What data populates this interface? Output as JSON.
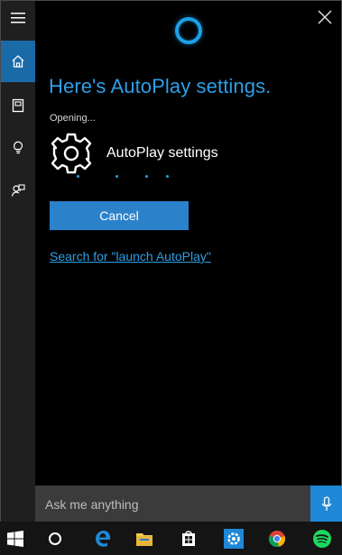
{
  "cortana": {
    "heading": "Here's AutoPlay settings.",
    "status": "Opening...",
    "setting_name": "AutoPlay settings",
    "cancel_label": "Cancel",
    "search_link": "Search for \"launch AutoPlay\""
  },
  "search": {
    "placeholder": "Ask me anything"
  },
  "rail": {
    "items": [
      {
        "name": "menu",
        "icon": "hamburger-icon"
      },
      {
        "name": "home",
        "icon": "home-icon",
        "active": true
      },
      {
        "name": "notebook",
        "icon": "notebook-icon"
      },
      {
        "name": "reminders",
        "icon": "lightbulb-icon"
      },
      {
        "name": "feedback",
        "icon": "feedback-icon"
      }
    ]
  },
  "taskbar": {
    "items": [
      "start-icon",
      "cortana-icon",
      "edge-icon",
      "file-explorer-icon",
      "store-icon",
      "settings-icon",
      "chrome-icon",
      "spotify-icon"
    ]
  },
  "colors": {
    "accent": "#2d9fe6",
    "button": "#2b82cb",
    "rail_active": "#1b6aa8"
  }
}
